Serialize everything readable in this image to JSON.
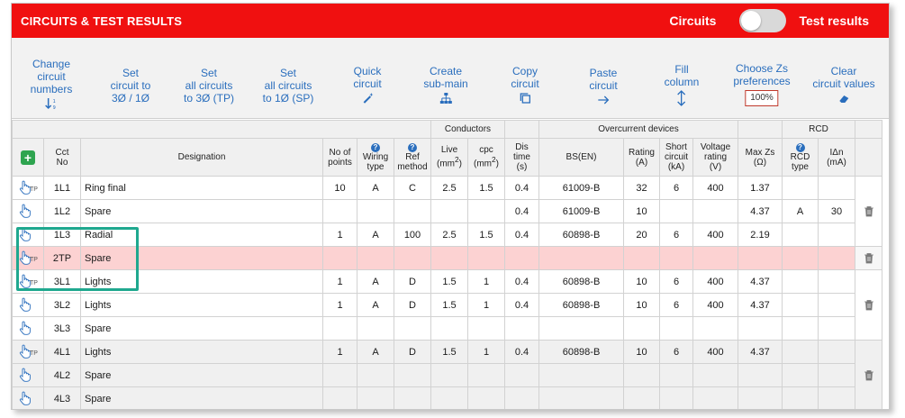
{
  "title": "CIRCUITS & TEST RESULTS",
  "modes": {
    "left": "Circuits",
    "right": "Test results"
  },
  "toolbar": {
    "change": [
      "Change",
      "circuit",
      "numbers"
    ],
    "set3": [
      "Set",
      "circuit to",
      "3Ø / 1Ø"
    ],
    "setTP": [
      "Set",
      "all circuits",
      "to 3Ø (TP)"
    ],
    "setSP": [
      "Set",
      "all circuits",
      "to 1Ø (SP)"
    ],
    "quick": [
      "Quick",
      "circuit"
    ],
    "submain": [
      "Create",
      "sub-main"
    ],
    "copy": [
      "Copy",
      "circuit"
    ],
    "paste": [
      "Paste",
      "circuit"
    ],
    "fill": [
      "Fill",
      "column"
    ],
    "prefs": [
      "Choose Zs",
      "preferences"
    ],
    "prefs_value": "100%",
    "clear": [
      "Clear",
      "circuit values"
    ]
  },
  "groups": {
    "conductors": "Conductors",
    "overcurrent": "Overcurrent devices",
    "rcd": "RCD"
  },
  "headers": {
    "cct": [
      "Cct",
      "No"
    ],
    "designation": "Designation",
    "points": [
      "No of",
      "points"
    ],
    "wiring": [
      "Wiring",
      "type"
    ],
    "ref": [
      "Ref",
      "method"
    ],
    "live": "Live",
    "cpc": "cpc",
    "unit": "(mm",
    "sup": "2",
    "close": ")",
    "dis": [
      "Dis",
      "time",
      "(s)"
    ],
    "bsen": "BS(EN)",
    "rating": [
      "Rating",
      "(A)"
    ],
    "short": [
      "Short",
      "circuit",
      "(kA)"
    ],
    "voltage": [
      "Voltage",
      "rating",
      "(V)"
    ],
    "maxzs": [
      "Max Zs",
      "(Ω)"
    ],
    "rcdtype": [
      "RCD",
      "type"
    ],
    "idn": [
      "IΔn",
      "(mA)"
    ]
  },
  "tp_label": "TP",
  "rows": [
    {
      "tp": true,
      "cct": "1L1",
      "designation": "Ring final",
      "points": "10",
      "wiring": "A",
      "ref": "C",
      "live": "2.5",
      "cpc": "1.5",
      "dis": "0.4",
      "bsen": "61009-B",
      "rating": "32",
      "short": "6",
      "voltage": "400",
      "maxzs": "1.37",
      "rcdtype": "",
      "idn": ""
    },
    {
      "tp": false,
      "cct": "1L2",
      "designation": "Spare",
      "points": "",
      "wiring": "",
      "ref": "",
      "live": "",
      "cpc": "",
      "dis": "0.4",
      "bsen": "61009-B",
      "rating": "10",
      "short": "",
      "voltage": "",
      "maxzs": "4.37",
      "rcdtype": "A",
      "idn": "30"
    },
    {
      "tp": false,
      "cct": "1L3",
      "designation": "Radial",
      "points": "1",
      "wiring": "A",
      "ref": "100",
      "live": "2.5",
      "cpc": "1.5",
      "dis": "0.4",
      "bsen": "60898-B",
      "rating": "20",
      "short": "6",
      "voltage": "400",
      "maxzs": "2.19",
      "rcdtype": "",
      "idn": ""
    },
    {
      "tp": true,
      "cct": "2TP",
      "designation": "Spare",
      "points": "",
      "wiring": "",
      "ref": "",
      "live": "",
      "cpc": "",
      "dis": "",
      "bsen": "",
      "rating": "",
      "short": "",
      "voltage": "",
      "maxzs": "",
      "rcdtype": "",
      "idn": ""
    },
    {
      "tp": true,
      "cct": "3L1",
      "designation": "Lights",
      "points": "1",
      "wiring": "A",
      "ref": "D",
      "live": "1.5",
      "cpc": "1",
      "dis": "0.4",
      "bsen": "60898-B",
      "rating": "10",
      "short": "6",
      "voltage": "400",
      "maxzs": "4.37",
      "rcdtype": "",
      "idn": ""
    },
    {
      "tp": false,
      "cct": "3L2",
      "designation": "Lights",
      "points": "1",
      "wiring": "A",
      "ref": "D",
      "live": "1.5",
      "cpc": "1",
      "dis": "0.4",
      "bsen": "60898-B",
      "rating": "10",
      "short": "6",
      "voltage": "400",
      "maxzs": "4.37",
      "rcdtype": "",
      "idn": ""
    },
    {
      "tp": false,
      "cct": "3L3",
      "designation": "Spare",
      "points": "",
      "wiring": "",
      "ref": "",
      "live": "",
      "cpc": "",
      "dis": "",
      "bsen": "",
      "rating": "",
      "short": "",
      "voltage": "",
      "maxzs": "",
      "rcdtype": "",
      "idn": ""
    },
    {
      "tp": true,
      "cct": "4L1",
      "designation": "Lights",
      "points": "1",
      "wiring": "A",
      "ref": "D",
      "live": "1.5",
      "cpc": "1",
      "dis": "0.4",
      "bsen": "60898-B",
      "rating": "10",
      "short": "6",
      "voltage": "400",
      "maxzs": "4.37",
      "rcdtype": "",
      "idn": ""
    },
    {
      "tp": false,
      "cct": "4L2",
      "designation": "Spare",
      "points": "",
      "wiring": "",
      "ref": "",
      "live": "",
      "cpc": "",
      "dis": "",
      "bsen": "",
      "rating": "",
      "short": "",
      "voltage": "",
      "maxzs": "",
      "rcdtype": "",
      "idn": ""
    },
    {
      "tp": false,
      "cct": "4L3",
      "designation": "Spare",
      "points": "",
      "wiring": "",
      "ref": "",
      "live": "",
      "cpc": "",
      "dis": "",
      "bsen": "",
      "rating": "",
      "short": "",
      "voltage": "",
      "maxzs": "",
      "rcdtype": "",
      "idn": ""
    }
  ],
  "colors": {
    "titlebar": "#f01010",
    "link": "#2a6ebd",
    "highlight_row": "#fcd2d2",
    "callout": "#1fa88f",
    "add": "#2ea44f"
  }
}
